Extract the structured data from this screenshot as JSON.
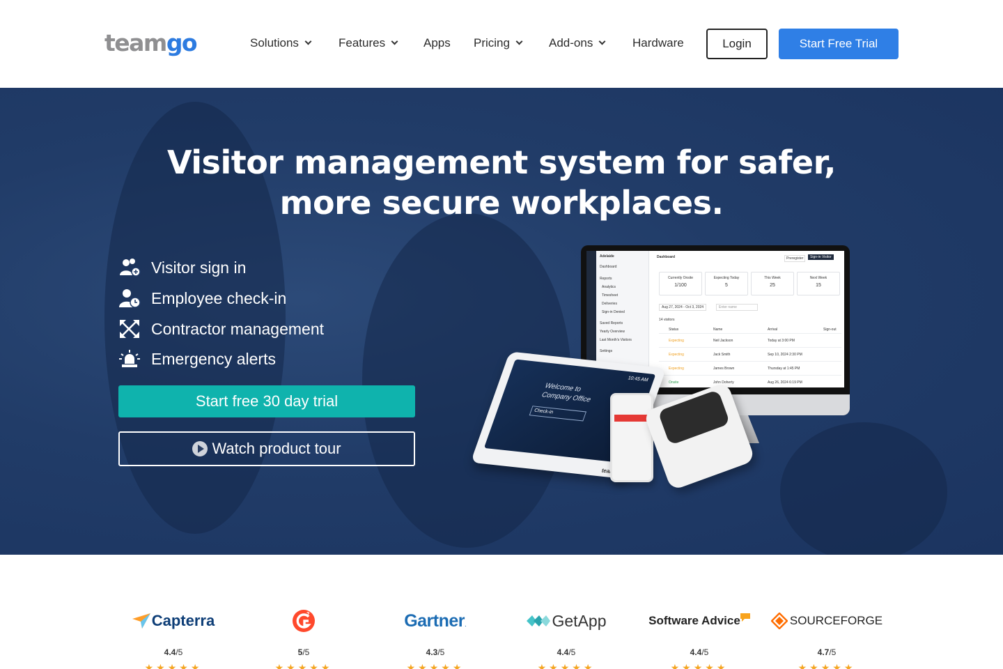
{
  "header": {
    "logo": {
      "part1": "team",
      "part2": "go"
    },
    "nav": [
      {
        "label": "Solutions",
        "has_dropdown": true
      },
      {
        "label": "Features",
        "has_dropdown": true
      },
      {
        "label": "Apps",
        "has_dropdown": false
      },
      {
        "label": "Pricing",
        "has_dropdown": true
      },
      {
        "label": "Add-ons",
        "has_dropdown": true
      },
      {
        "label": "Hardware",
        "has_dropdown": false
      }
    ],
    "login_label": "Login",
    "trial_label": "Start Free Trial"
  },
  "hero": {
    "title_line1": "Visitor management system for safer,",
    "title_line2": "more secure workplaces.",
    "features": [
      {
        "icon": "users-plus-icon",
        "label": "Visitor sign in"
      },
      {
        "icon": "user-clock-icon",
        "label": "Employee check-in"
      },
      {
        "icon": "expand-arrows-icon",
        "label": "Contractor management"
      },
      {
        "icon": "alarm-light-icon",
        "label": "Emergency alerts"
      }
    ],
    "cta_primary": "Start free 30 day trial",
    "cta_secondary": "Watch product tour",
    "device_screen": {
      "location": "Adelaide",
      "title": "Dashboard",
      "preregister": "Preregister",
      "sign_in_visitor": "Sign-in Visitor",
      "menu": [
        "Dashboard",
        "Reports",
        "Analytics",
        "Timesheet",
        "Deliveries",
        "Sign-in Denied",
        "Saved Reports",
        "Yearly Overview",
        "Last Month's Visitors",
        "Settings"
      ],
      "tiles": [
        {
          "label": "Currently Onsite",
          "value": "1/100"
        },
        {
          "label": "Expecting Today",
          "value": "5"
        },
        {
          "label": "This Week",
          "value": "25"
        },
        {
          "label": "Next Week",
          "value": "15"
        }
      ],
      "date_range": "Aug 27, 2024 - Oct 3, 2024",
      "search_placeholder": "Enter name",
      "visitor_count": "14 visitors",
      "columns": [
        "Status",
        "Name",
        "Arrival",
        "Sign-out"
      ],
      "rows": [
        {
          "status": "Expecting",
          "name": "Neil Jackson",
          "arrival": "Today at 3:00 PM"
        },
        {
          "status": "Expecting",
          "name": "Jack Smith",
          "arrival": "Sep 10, 2024 2:30 PM"
        },
        {
          "status": "Expecting",
          "name": "James Brown",
          "arrival": "Thursday at 1:45 PM"
        },
        {
          "status": "Onsite",
          "name": "John Doherty",
          "arrival": "Aug 26, 2024 6:19 PM"
        }
      ],
      "tablet_welcome": "Welcome to Company Office",
      "tablet_time": "10:45 AM",
      "tablet_checkin": "Check-in",
      "tablet_brand": "teamgo"
    }
  },
  "ratings": [
    {
      "name": "Capterra",
      "score": "4.4",
      "max": "/5",
      "color": "#0e3e77"
    },
    {
      "name": "G2",
      "score": "5",
      "max": "/5",
      "color": "#ff492c"
    },
    {
      "name": "Gartner",
      "score": "4.3",
      "max": "/5",
      "color": "#1c6cb3"
    },
    {
      "name": "GetApp",
      "score": "4.4",
      "max": "/5",
      "color": "#333333"
    },
    {
      "name": "Software Advice",
      "score": "4.4",
      "max": "/5",
      "color": "#222222"
    },
    {
      "name": "SOURCEFORGE",
      "score": "4.7",
      "max": "/5",
      "color": "#ff6d00"
    }
  ],
  "colors": {
    "brand_blue": "#2f7fe6",
    "teal": "#0fb3ad",
    "hero_bg": "#213c68",
    "star": "#f4a623"
  }
}
